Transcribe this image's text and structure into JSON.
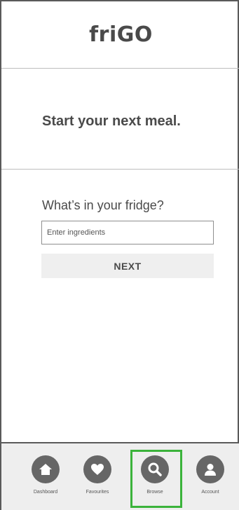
{
  "header": {
    "logo_text": "friGO"
  },
  "hero": {
    "title": "Start your next meal."
  },
  "search": {
    "label": "What’s in your fridge?",
    "placeholder": "Enter ingredients",
    "next_label": "NEXT"
  },
  "tabbar": {
    "items": [
      {
        "label": "Dashboard",
        "icon": "home-icon"
      },
      {
        "label": "Favourites",
        "icon": "heart-icon"
      },
      {
        "label": "Browse",
        "icon": "search-icon",
        "selected": true
      },
      {
        "label": "Account",
        "icon": "user-icon"
      }
    ],
    "highlight_color": "#3bb33b"
  }
}
